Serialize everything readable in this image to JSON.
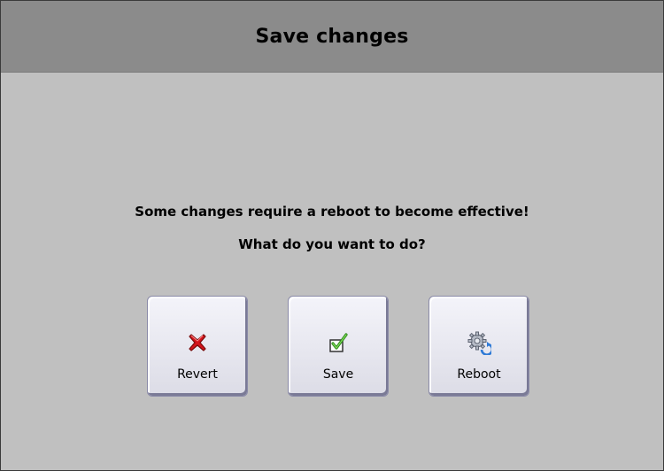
{
  "dialog": {
    "title": "Save changes",
    "message": "Some changes require a reboot to become effective!",
    "question": "What do you want to do?"
  },
  "buttons": [
    {
      "label": "Revert",
      "icon": "red-x-icon"
    },
    {
      "label": "Save",
      "icon": "checkmark-icon"
    },
    {
      "label": "Reboot",
      "icon": "gear-reboot-icon"
    }
  ],
  "colors": {
    "titlebar": "#8b8b8b",
    "background": "#c0c0c0",
    "revert_icon": "#d4141c",
    "save_check": "#3a9a22"
  }
}
